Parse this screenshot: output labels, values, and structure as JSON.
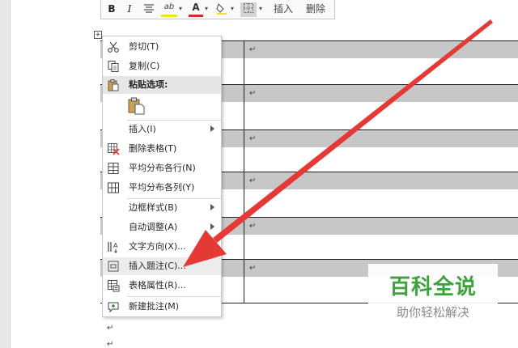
{
  "mini_toolbar": {
    "bold": "B",
    "italic": "I",
    "highlight": "ab",
    "font_color": "A",
    "insert": "插入",
    "delete": "删除"
  },
  "table": {
    "cell_mark": "↵"
  },
  "paragraph_marks": [
    "↵",
    "↵"
  ],
  "context_menu": {
    "cut": "剪切(T)",
    "copy": "复制(C)",
    "paste_options": "粘贴选项:",
    "insert": "插入(I)",
    "delete_table": "删除表格(T)",
    "distribute_rows": "平均分布各行(N)",
    "distribute_columns": "平均分布各列(Y)",
    "border_styles": "边框样式(B)",
    "autofit": "自动调整(A)",
    "text_direction": "文字方向(X)...",
    "insert_caption": "插入题注(C)...",
    "table_properties": "表格属性(R)...",
    "new_comment": "新建批注(M)"
  },
  "watermark": {
    "title": "百科全说",
    "subtitle": "助你轻松解决"
  },
  "colors": {
    "arrow": "#e53935",
    "watermark_green": "#3ca33c",
    "row_shade": "#c7c7c7",
    "font_color_underline": "#d62828",
    "highlight_yellow": "#f4e21a"
  },
  "icons": {
    "cut": "scissors-icon",
    "copy": "copy-icon",
    "paste": "clipboard-icon",
    "delete_table": "delete-table-icon",
    "distribute_rows": "distribute-rows-icon",
    "distribute_columns": "distribute-columns-icon",
    "text_direction": "text-direction-icon",
    "insert_caption": "caption-icon",
    "table_properties": "table-properties-icon",
    "new_comment": "comment-icon"
  }
}
